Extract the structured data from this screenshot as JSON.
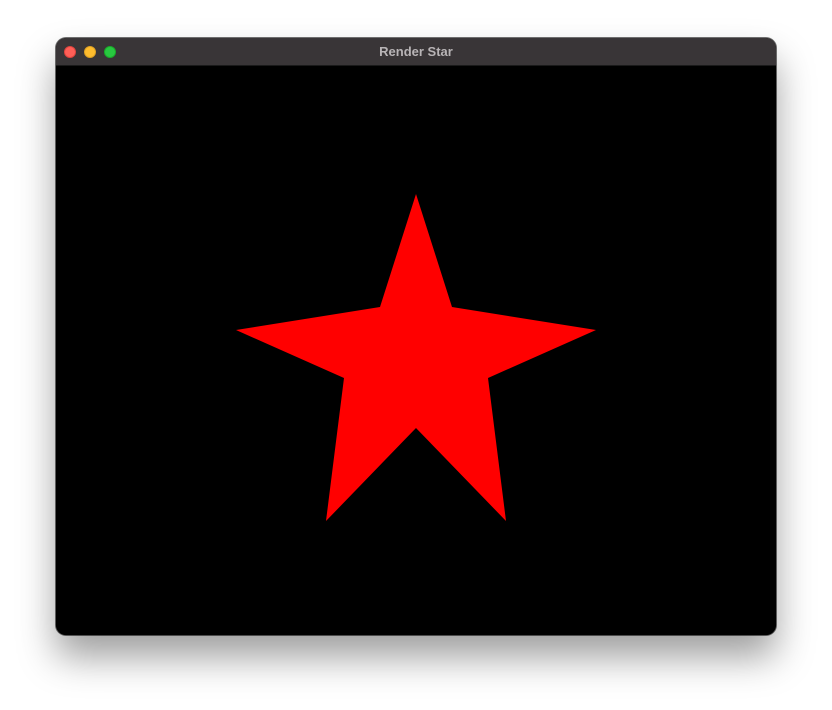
{
  "window": {
    "title": "Render Star"
  },
  "canvas": {
    "background_color": "#000000",
    "shape": "five-point-star",
    "fill_color": "#ff0000"
  },
  "colors": {
    "titlebar": "#393537",
    "title_text": "#b8b4b6",
    "close": "#ff5f57",
    "minimize": "#febc2e",
    "zoom": "#28c840"
  }
}
